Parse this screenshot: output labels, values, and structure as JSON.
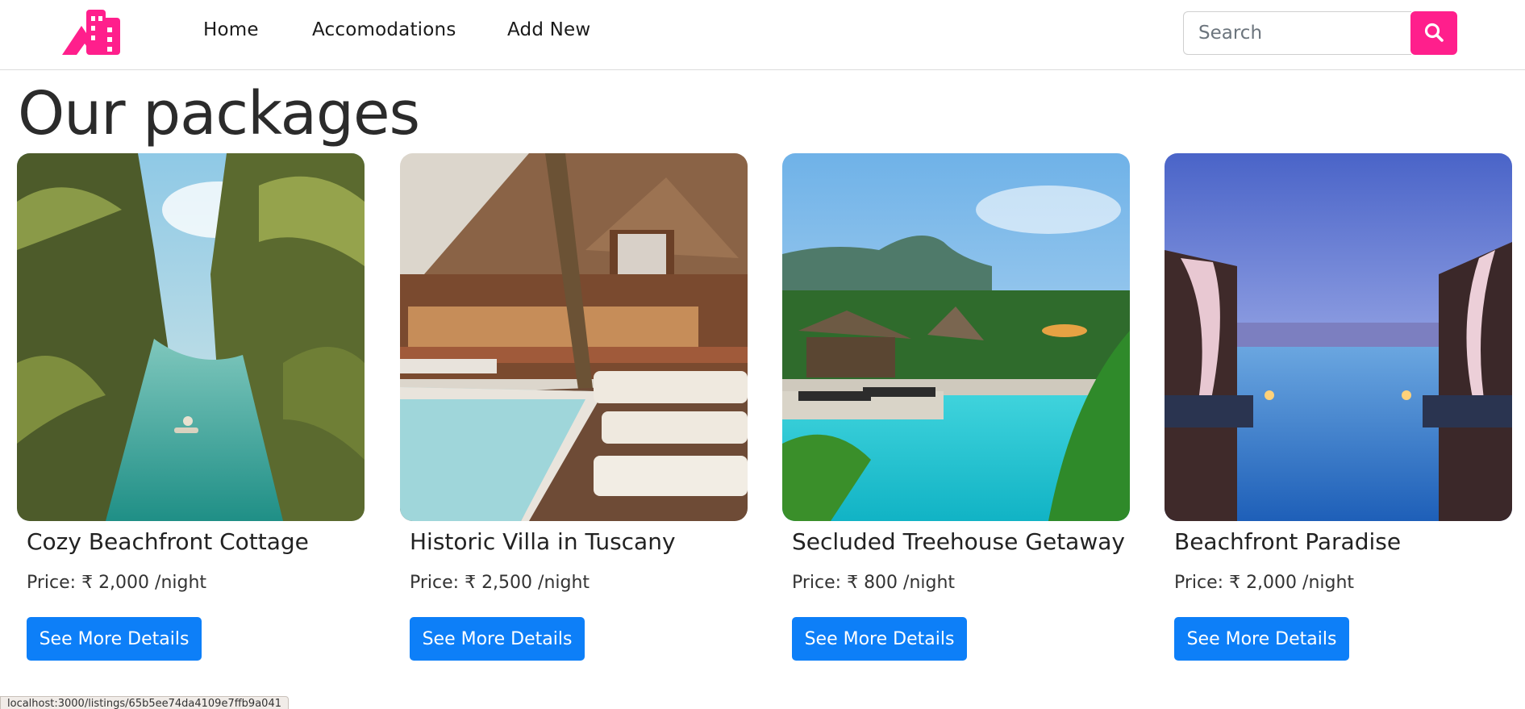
{
  "colors": {
    "brand": "#ff1f8c",
    "button": "#0d7ff8"
  },
  "navbar": {
    "logo_icon": "brand-buildings-icon",
    "links": [
      "Home",
      "Accomodations",
      "Add New"
    ],
    "search": {
      "placeholder": "Search",
      "value": "",
      "button_icon": "search-icon"
    }
  },
  "page": {
    "title": "Our packages"
  },
  "cards": [
    {
      "title": "Cozy Beachfront Cottage",
      "price": "Price: ₹ 2,000 /night",
      "button": "See More Details"
    },
    {
      "title": "Historic Villa in Tuscany",
      "price": "Price: ₹ 2,500 /night",
      "button": "See More Details"
    },
    {
      "title": "Secluded Treehouse Getaway",
      "price": "Price: ₹ 800 /night",
      "button": "See More Details"
    },
    {
      "title": "Beachfront Paradise",
      "price": "Price: ₹ 2,000 /night",
      "button": "See More Details"
    }
  ],
  "status_bar": {
    "url": "localhost:3000/listings/65b5ee74da4109e7ffb9a041"
  }
}
